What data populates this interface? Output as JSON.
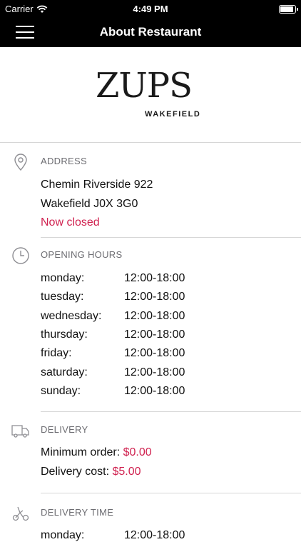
{
  "status_bar": {
    "carrier": "Carrier",
    "time": "4:49 PM"
  },
  "nav": {
    "title": "About Restaurant"
  },
  "logo": {
    "name": "ZUPS",
    "subtitle": "WAKEFIELD"
  },
  "address": {
    "heading": "ADDRESS",
    "line1": "Chemin Riverside 922",
    "line2": "Wakefield J0X 3G0",
    "status": "Now closed"
  },
  "opening_hours": {
    "heading": "OPENING HOURS",
    "rows": [
      {
        "day": "monday:",
        "hours": "12:00-18:00"
      },
      {
        "day": "tuesday:",
        "hours": "12:00-18:00"
      },
      {
        "day": "wednesday:",
        "hours": "12:00-18:00"
      },
      {
        "day": "thursday:",
        "hours": "12:00-18:00"
      },
      {
        "day": "friday:",
        "hours": "12:00-18:00"
      },
      {
        "day": "saturday:",
        "hours": "12:00-18:00"
      },
      {
        "day": "sunday:",
        "hours": "12:00-18:00"
      }
    ]
  },
  "delivery": {
    "heading": "DELIVERY",
    "min_order_label": "Minimum order:",
    "min_order_value": "$0.00",
    "cost_label": "Delivery cost:",
    "cost_value": "$5.00"
  },
  "delivery_time": {
    "heading": "DELIVERY TIME",
    "rows": [
      {
        "day": "monday:",
        "hours": "12:00-18:00"
      }
    ]
  },
  "colors": {
    "accent": "#d0214f",
    "bar": "#000000",
    "divider": "#d6d6d6",
    "heading": "#6d6d72"
  }
}
